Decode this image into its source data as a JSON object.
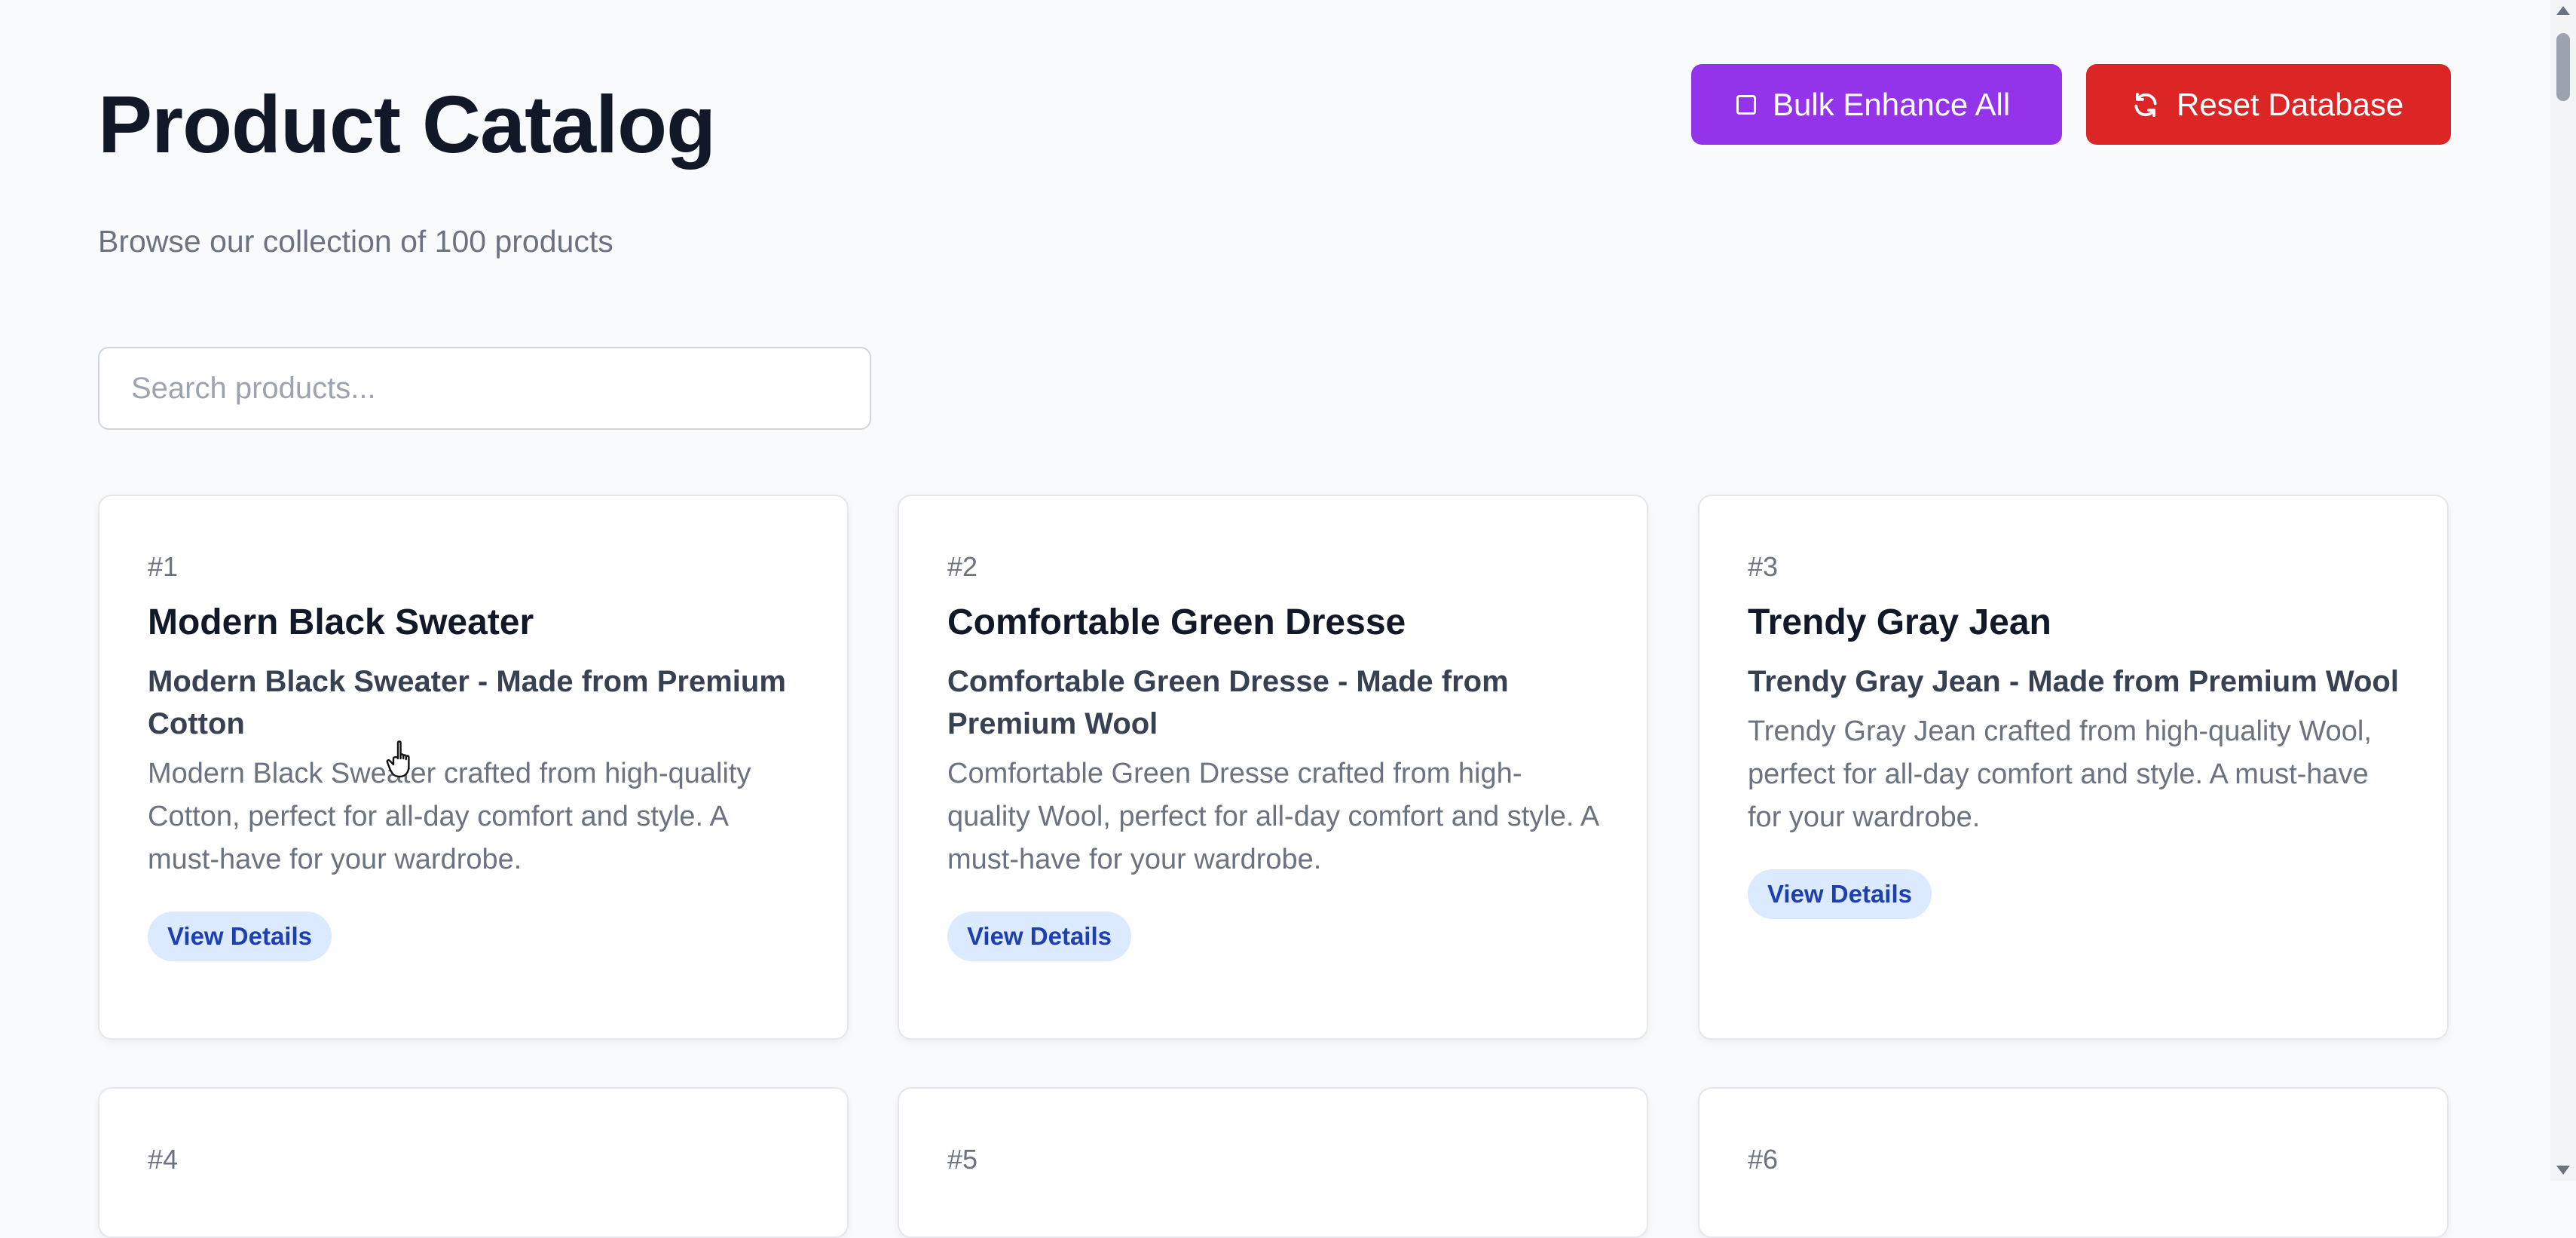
{
  "header": {
    "title": "Product Catalog",
    "subtitle": "Browse our collection of 100 products"
  },
  "actions": {
    "bulk_enhance_label": "Bulk Enhance All",
    "reset_database_label": "Reset Database"
  },
  "search": {
    "placeholder": "Search products...",
    "value": ""
  },
  "products": [
    {
      "number": "#1",
      "name": "Modern Black Sweater",
      "headline": "Modern Black Sweater - Made from Premium Cotton",
      "description": "Modern Black Sweater crafted from high-quality Cotton, perfect for all-day comfort and style. A must-have for your wardrobe.",
      "button_label": "View Details"
    },
    {
      "number": "#2",
      "name": "Comfortable Green Dresse",
      "headline": "Comfortable Green Dresse - Made from Premium Wool",
      "description": "Comfortable Green Dresse crafted from high-quality Wool, perfect for all-day comfort and style. A must-have for your wardrobe.",
      "button_label": "View Details"
    },
    {
      "number": "#3",
      "name": "Trendy Gray Jean",
      "headline": "Trendy Gray Jean - Made from Premium Wool",
      "description": "Trendy Gray Jean crafted from high-quality Wool, perfect for all-day comfort and style. A must-have for your wardrobe.",
      "button_label": "View Details"
    },
    {
      "number": "#4"
    },
    {
      "number": "#5"
    },
    {
      "number": "#6"
    }
  ],
  "colors": {
    "bulk_enhance": "#9333ea",
    "reset_database": "#dc2626",
    "view_details_bg": "#dbeafe",
    "view_details_text": "#1e40af"
  }
}
